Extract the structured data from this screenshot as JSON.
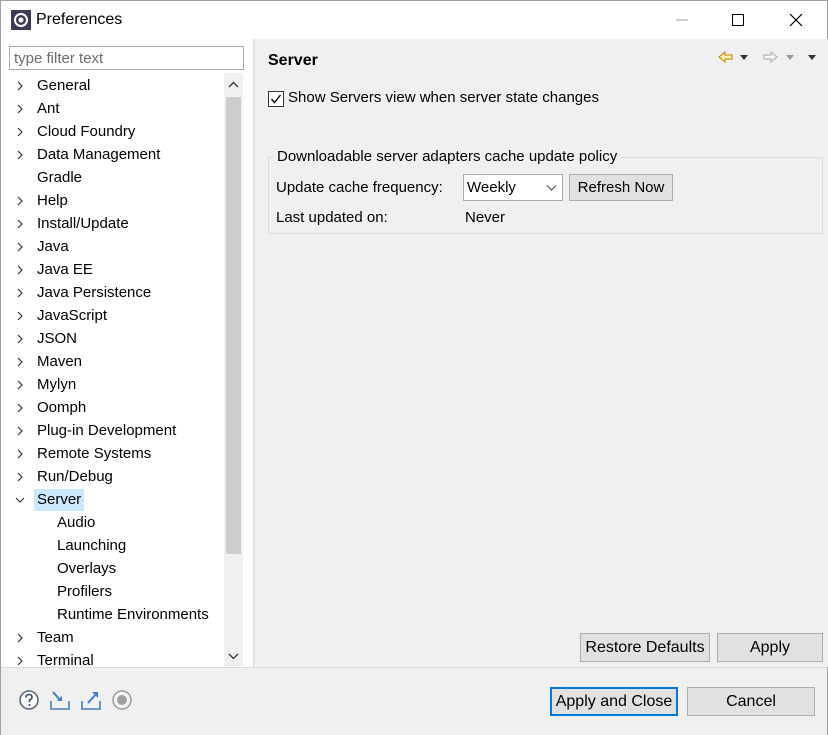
{
  "window": {
    "title": "Preferences"
  },
  "filter": {
    "placeholder": "type filter text"
  },
  "tree": {
    "items": [
      {
        "label": "General",
        "expanded": false
      },
      {
        "label": "Ant",
        "expanded": false
      },
      {
        "label": "Cloud Foundry",
        "expanded": false
      },
      {
        "label": "Data Management",
        "expanded": false
      },
      {
        "label": "Gradle"
      },
      {
        "label": "Help",
        "expanded": false
      },
      {
        "label": "Install/Update",
        "expanded": false
      },
      {
        "label": "Java",
        "expanded": false
      },
      {
        "label": "Java EE",
        "expanded": false
      },
      {
        "label": "Java Persistence",
        "expanded": false
      },
      {
        "label": "JavaScript",
        "expanded": false
      },
      {
        "label": "JSON",
        "expanded": false
      },
      {
        "label": "Maven",
        "expanded": false
      },
      {
        "label": "Mylyn",
        "expanded": false
      },
      {
        "label": "Oomph",
        "expanded": false
      },
      {
        "label": "Plug-in Development",
        "expanded": false
      },
      {
        "label": "Remote Systems",
        "expanded": false
      },
      {
        "label": "Run/Debug",
        "expanded": false
      },
      {
        "label": "Server",
        "expanded": true,
        "selected": true
      },
      {
        "label": "Audio",
        "child": true
      },
      {
        "label": "Launching",
        "child": true
      },
      {
        "label": "Overlays",
        "child": true
      },
      {
        "label": "Profilers",
        "child": true
      },
      {
        "label": "Runtime Environments",
        "child": true
      },
      {
        "label": "Team",
        "expanded": false
      },
      {
        "label": "Terminal",
        "expanded": false
      }
    ]
  },
  "page": {
    "title": "Server",
    "show_servers_label": "Show Servers view when server state changes",
    "show_servers_checked": true,
    "group": {
      "legend": "Downloadable server adapters cache update policy",
      "freq_label": "Update cache frequency:",
      "freq_value": "Weekly",
      "refresh_label": "Refresh Now",
      "last_label": "Last updated on:",
      "last_value": "Never"
    },
    "restore_defaults_label": "Restore Defaults",
    "apply_label": "Apply"
  },
  "footer": {
    "apply_close_label": "Apply and Close",
    "cancel_label": "Cancel"
  },
  "colors": {
    "selection": "#cce8ff",
    "accent": "#0078d7",
    "nav_back": "#d4a017"
  }
}
